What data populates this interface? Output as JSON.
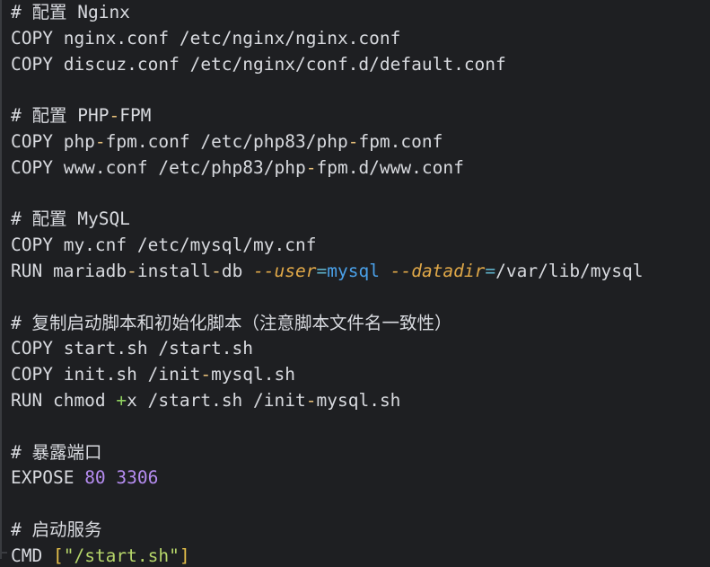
{
  "code": {
    "l1": "# 配置 Nginx",
    "l2": "COPY nginx.conf /etc/nginx/nginx.conf",
    "l3": "COPY discuz.conf /etc/nginx/conf.d/default.conf",
    "l5": "# 配置 PHP-FPM",
    "l5_parts": [
      "# 配置 PHP",
      "-",
      "FPM"
    ],
    "l6_parts": [
      "COPY php",
      "-",
      "fpm.conf /etc/php83/php",
      "-",
      "fpm.conf"
    ],
    "l7_parts": [
      "COPY www.conf /etc/php83/php",
      "-",
      "fpm.d/www.conf"
    ],
    "l9": "# 配置 MySQL",
    "l10": "COPY my.cnf /etc/mysql/my.cnf",
    "l11_parts": [
      "RUN mariadb",
      "-",
      "install",
      "-",
      "db ",
      "--user",
      "=",
      "mysql",
      " ",
      "--datadir",
      "=",
      "/var/lib/mysql"
    ],
    "l13": "# 复制启动脚本和初始化脚本（注意脚本文件名一致性）",
    "l14": "COPY start.sh /start.sh",
    "l15_parts": [
      "COPY init.sh /init",
      "-",
      "mysql.sh"
    ],
    "l16_parts": [
      "RUN chmod ",
      "+",
      "x /start.sh /init",
      "-",
      "mysql.sh"
    ],
    "l18": "# 暴露端口",
    "l19_parts": [
      "EXPOSE ",
      "80",
      " ",
      "3306"
    ],
    "l21": "# 启动服务",
    "l22_parts": [
      "CMD ",
      "[",
      "\"/start.sh\"",
      "]"
    ]
  },
  "colors": {
    "background": "#1e1f22",
    "text": "#d8dadf",
    "operator": "#e8c07a",
    "option": "#e0a848",
    "value": "#4aa0e8",
    "number": "#b58cf0",
    "string": "#b6d66a"
  }
}
